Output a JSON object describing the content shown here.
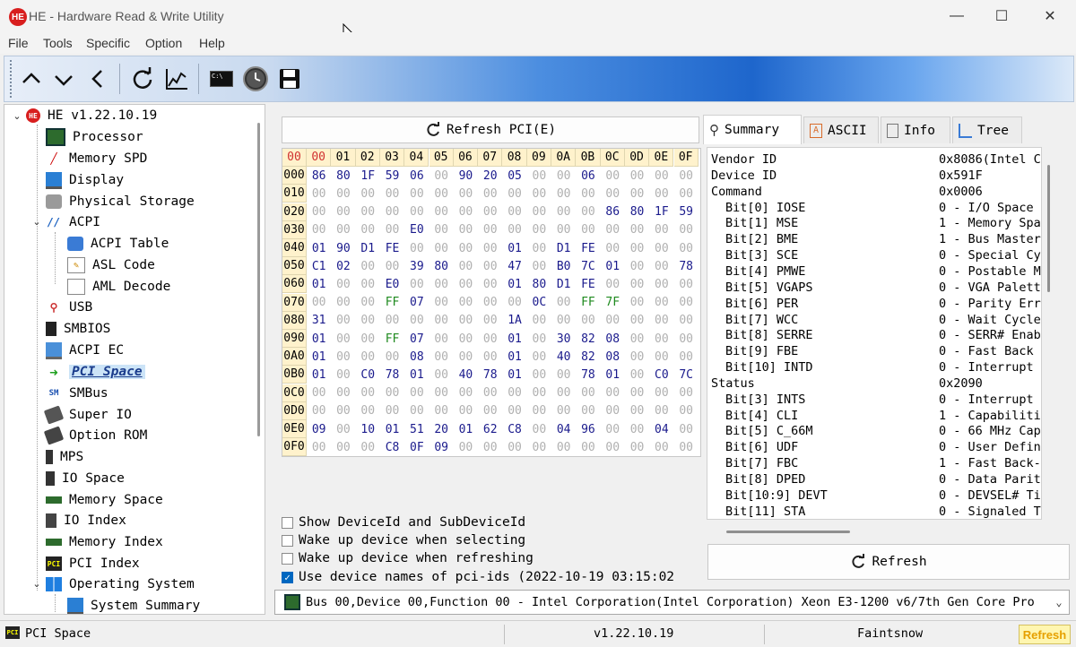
{
  "window": {
    "title": "HE - Hardware Read & Write Utility",
    "logo": "HE",
    "controls": {
      "minimize": "—",
      "maximize": "☐",
      "close": "✕"
    }
  },
  "menu": [
    "File",
    "Tools",
    "Specific",
    "Option",
    "Help"
  ],
  "toolbar": {
    "buttons": [
      "up-arrow-icon",
      "down-arrow-icon",
      "back-arrow-icon",
      "refresh-icon",
      "chart-icon",
      "terminal-icon",
      "clock-icon",
      "save-icon"
    ],
    "terminal_text": "C:\\"
  },
  "tree": {
    "root": "HE v1.22.10.19",
    "items": [
      {
        "label": "Processor",
        "icon": "chip-icon"
      },
      {
        "label": "Memory SPD",
        "icon": "memory-spd-icon"
      },
      {
        "label": "Display",
        "icon": "monitor-icon"
      },
      {
        "label": "Physical Storage",
        "icon": "storage-icon"
      },
      {
        "label": "ACPI",
        "icon": "acpi-icon"
      },
      {
        "label": "ACPI Table",
        "icon": "table-icon"
      },
      {
        "label": "ASL Code",
        "icon": "code-icon"
      },
      {
        "label": "AML Decode",
        "icon": "decode-icon"
      },
      {
        "label": "USB",
        "icon": "usb-icon"
      },
      {
        "label": "SMBIOS",
        "icon": "smbios-icon"
      },
      {
        "label": "ACPI EC",
        "icon": "laptop-icon"
      },
      {
        "label": "PCI Space",
        "icon": "arrow-right-icon"
      },
      {
        "label": "SMBus",
        "icon": "smbus-icon"
      },
      {
        "label": "Super IO",
        "icon": "superio-icon"
      },
      {
        "label": "Option ROM",
        "icon": "rom-icon"
      },
      {
        "label": "MPS",
        "icon": "mps-icon"
      },
      {
        "label": "IO Space",
        "icon": "io-icon"
      },
      {
        "label": "Memory Space",
        "icon": "memory-icon"
      },
      {
        "label": "IO Index",
        "icon": "io-index-icon"
      },
      {
        "label": "Memory Index",
        "icon": "memory-index-icon"
      },
      {
        "label": "PCI Index",
        "icon": "pci-index-icon"
      },
      {
        "label": "Operating System",
        "icon": "windows-icon"
      },
      {
        "label": "System Summary",
        "icon": "system-icon"
      }
    ]
  },
  "pci": {
    "refresh_label": "Refresh PCI(E)",
    "columns": [
      "00",
      "01",
      "02",
      "03",
      "04",
      "05",
      "06",
      "07",
      "08",
      "09",
      "0A",
      "0B",
      "0C",
      "0D",
      "0E",
      "0F"
    ],
    "rows": [
      {
        "addr": "000",
        "cells": [
          "86",
          "80",
          "1F",
          "59",
          "06",
          "00",
          "90",
          "20",
          "05",
          "00",
          "00",
          "06",
          "00",
          "00",
          "00",
          "00"
        ]
      },
      {
        "addr": "010",
        "cells": [
          "00",
          "00",
          "00",
          "00",
          "00",
          "00",
          "00",
          "00",
          "00",
          "00",
          "00",
          "00",
          "00",
          "00",
          "00",
          "00"
        ]
      },
      {
        "addr": "020",
        "cells": [
          "00",
          "00",
          "00",
          "00",
          "00",
          "00",
          "00",
          "00",
          "00",
          "00",
          "00",
          "00",
          "86",
          "80",
          "1F",
          "59"
        ]
      },
      {
        "addr": "030",
        "cells": [
          "00",
          "00",
          "00",
          "00",
          "E0",
          "00",
          "00",
          "00",
          "00",
          "00",
          "00",
          "00",
          "00",
          "00",
          "00",
          "00"
        ]
      },
      {
        "addr": "040",
        "cells": [
          "01",
          "90",
          "D1",
          "FE",
          "00",
          "00",
          "00",
          "00",
          "01",
          "00",
          "D1",
          "FE",
          "00",
          "00",
          "00",
          "00"
        ]
      },
      {
        "addr": "050",
        "cells": [
          "C1",
          "02",
          "00",
          "00",
          "39",
          "80",
          "00",
          "00",
          "47",
          "00",
          "B0",
          "7C",
          "01",
          "00",
          "00",
          "78"
        ]
      },
      {
        "addr": "060",
        "cells": [
          "01",
          "00",
          "00",
          "E0",
          "00",
          "00",
          "00",
          "00",
          "01",
          "80",
          "D1",
          "FE",
          "00",
          "00",
          "00",
          "00"
        ]
      },
      {
        "addr": "070",
        "cells": [
          "00",
          "00",
          "00",
          "FF",
          "07",
          "00",
          "00",
          "00",
          "00",
          "0C",
          "00",
          "FF",
          "7F",
          "00",
          "00",
          "00"
        ]
      },
      {
        "addr": "080",
        "cells": [
          "31",
          "00",
          "00",
          "00",
          "00",
          "00",
          "00",
          "00",
          "1A",
          "00",
          "00",
          "00",
          "00",
          "00",
          "00",
          "00"
        ]
      },
      {
        "addr": "090",
        "cells": [
          "01",
          "00",
          "00",
          "FF",
          "07",
          "00",
          "00",
          "00",
          "01",
          "00",
          "30",
          "82",
          "08",
          "00",
          "00",
          "00"
        ]
      },
      {
        "addr": "0A0",
        "cells": [
          "01",
          "00",
          "00",
          "00",
          "08",
          "00",
          "00",
          "00",
          "01",
          "00",
          "40",
          "82",
          "08",
          "00",
          "00",
          "00"
        ]
      },
      {
        "addr": "0B0",
        "cells": [
          "01",
          "00",
          "C0",
          "78",
          "01",
          "00",
          "40",
          "78",
          "01",
          "00",
          "00",
          "78",
          "01",
          "00",
          "C0",
          "7C"
        ]
      },
      {
        "addr": "0C0",
        "cells": [
          "00",
          "00",
          "00",
          "00",
          "00",
          "00",
          "00",
          "00",
          "00",
          "00",
          "00",
          "00",
          "00",
          "00",
          "00",
          "00"
        ]
      },
      {
        "addr": "0D0",
        "cells": [
          "00",
          "00",
          "00",
          "00",
          "00",
          "00",
          "00",
          "00",
          "00",
          "00",
          "00",
          "00",
          "00",
          "00",
          "00",
          "00"
        ]
      },
      {
        "addr": "0E0",
        "cells": [
          "09",
          "00",
          "10",
          "01",
          "51",
          "20",
          "01",
          "62",
          "C8",
          "00",
          "04",
          "96",
          "00",
          "00",
          "04",
          "00"
        ]
      },
      {
        "addr": "0F0",
        "cells": [
          "00",
          "00",
          "00",
          "C8",
          "0F",
          "09",
          "00",
          "00",
          "00",
          "00",
          "00",
          "00",
          "00",
          "00",
          "00",
          "00"
        ]
      }
    ],
    "colors": {
      "value": "#1a1a8c",
      "zero": "#b0b0b0",
      "ff": "#1f8a1f",
      "header_bg": "#fff2cc",
      "selected_header": "#d03030"
    }
  },
  "options": [
    {
      "label": "Show DeviceId and SubDeviceId",
      "checked": false
    },
    {
      "label": "Wake up device when selecting",
      "checked": false
    },
    {
      "label": "Wake up device when refreshing",
      "checked": false
    },
    {
      "label": "Use device names of pci-ids (2022-10-19 03:15:02",
      "checked": true
    }
  ],
  "tabs": [
    {
      "label": "Summary",
      "icon": "search-icon",
      "active": true
    },
    {
      "label": "ASCII",
      "icon": "ascii-icon",
      "active": false
    },
    {
      "label": "Info",
      "icon": "document-icon",
      "active": false
    },
    {
      "label": "Tree",
      "icon": "tree-icon",
      "active": false
    }
  ],
  "summary": [
    {
      "name": "Vendor ID",
      "value": "0x8086(Intel C",
      "indent": false
    },
    {
      "name": "Device ID",
      "value": "0x591F",
      "indent": false
    },
    {
      "name": "Command",
      "value": "0x0006",
      "indent": false
    },
    {
      "name": "Bit[0] IOSE",
      "value": "0 - I/O Space",
      "indent": true
    },
    {
      "name": "Bit[1] MSE",
      "value": "1 - Memory Spa",
      "indent": true
    },
    {
      "name": "Bit[2] BME",
      "value": "1 - Bus Master",
      "indent": true
    },
    {
      "name": "Bit[3] SCE",
      "value": "0 - Special Cy",
      "indent": true
    },
    {
      "name": "Bit[4] PMWE",
      "value": "0 - Postable M",
      "indent": true
    },
    {
      "name": "Bit[5] VGAPS",
      "value": "0 - VGA Palett",
      "indent": true
    },
    {
      "name": "Bit[6] PER",
      "value": "0 - Parity Err",
      "indent": true
    },
    {
      "name": "Bit[7] WCC",
      "value": "0 - Wait Cycle",
      "indent": true
    },
    {
      "name": "Bit[8] SERRE",
      "value": "0 - SERR# Enab",
      "indent": true
    },
    {
      "name": "Bit[9] FBE",
      "value": "0 - Fast Back",
      "indent": true
    },
    {
      "name": "Bit[10] INTD",
      "value": "0 - Interrupt",
      "indent": true
    },
    {
      "name": "Status",
      "value": "0x2090",
      "indent": false
    },
    {
      "name": "Bit[3] INTS",
      "value": "0 - Interrupt",
      "indent": true
    },
    {
      "name": "Bit[4] CLI",
      "value": "1 - Capabiliti",
      "indent": true
    },
    {
      "name": "Bit[5] C_66M",
      "value": "0 - 66 MHz Cap",
      "indent": true
    },
    {
      "name": "Bit[6] UDF",
      "value": "0 - User Defin",
      "indent": true
    },
    {
      "name": "Bit[7] FBC",
      "value": "1 - Fast Back-",
      "indent": true
    },
    {
      "name": "Bit[8] DPED",
      "value": "0 - Data Parit",
      "indent": true
    },
    {
      "name": "Bit[10:9] DEVT",
      "value": "0 - DEVSEL# Ti",
      "indent": true
    },
    {
      "name": "Bit[11] STA",
      "value": "0 - Signaled T",
      "indent": true
    }
  ],
  "refresh_label": "Refresh",
  "device_select": "Bus 00,Device 00,Function 00 - Intel Corporation(Intel Corporation) Xeon E3-1200 v6/7th Gen Core Pro",
  "statusbar": {
    "left": "PCI Space",
    "version": "v1.22.10.19",
    "author": "Faintsnow",
    "refresh": "Refresh"
  }
}
